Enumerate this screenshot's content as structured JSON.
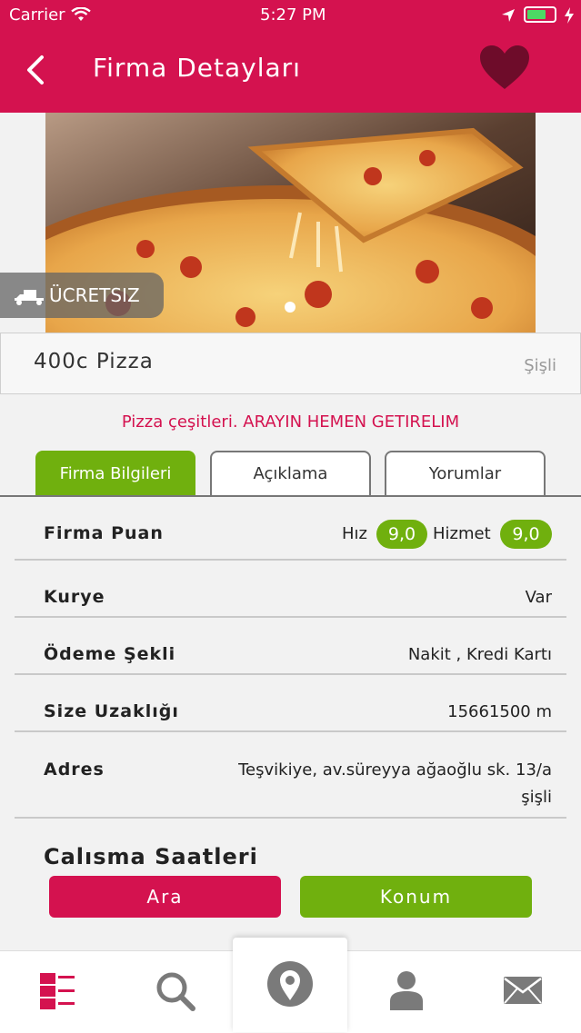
{
  "status": {
    "carrier": "Carrier",
    "time": "5:27 PM"
  },
  "header": {
    "title": "Firma Detayları"
  },
  "hero": {
    "badge": "ÜCRETSIZ"
  },
  "business": {
    "name": "400c Pizza",
    "district": "Şişli",
    "slogan": "Pizza çeşitleri. ARAYIN HEMEN GETIRELIM"
  },
  "tabs": [
    {
      "label": "Firma Bilgileri"
    },
    {
      "label": "Açıklama"
    },
    {
      "label": "Yorumlar"
    }
  ],
  "rating": {
    "label": "Firma Puan",
    "speed_label": "Hız",
    "speed_value": "9,0",
    "service_label": "Hizmet",
    "service_value": "9,0"
  },
  "rows": [
    {
      "label": "Kurye",
      "value": "Var"
    },
    {
      "label": "Ödeme Şekli",
      "value": "Nakit , Kredi Kartı"
    },
    {
      "label": "Size Uzaklığı",
      "value": "15661500 m"
    },
    {
      "label": "Adres",
      "value_line1": "Teşvikiye, av.süreyya ağaoğlu sk. 13/a",
      "value_line2": "şişli"
    }
  ],
  "section": {
    "hours_title": "Calısma Saatleri"
  },
  "actions": {
    "call": "Ara",
    "location": "Konum"
  },
  "colors": {
    "brand": "#d4124f",
    "accent": "#70b00e"
  }
}
